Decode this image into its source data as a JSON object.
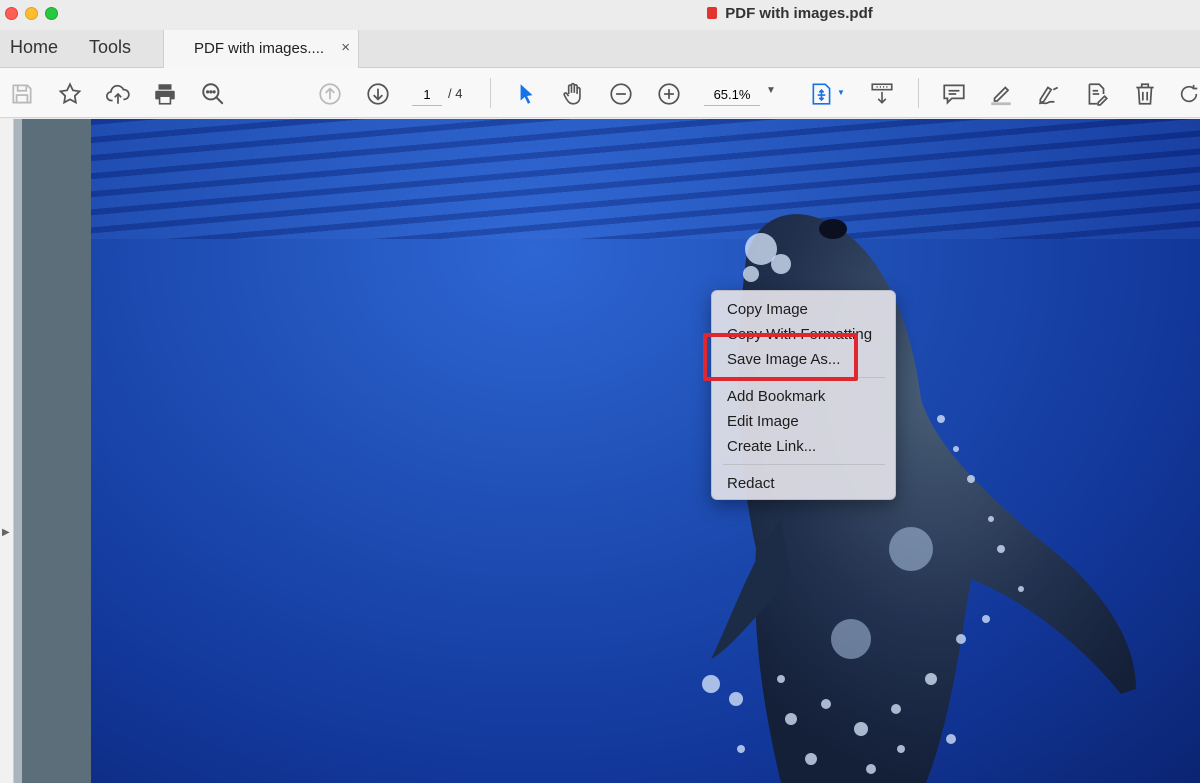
{
  "window": {
    "title": "PDF with images.pdf"
  },
  "nav": {
    "home": "Home",
    "tools": "Tools"
  },
  "doc_tab": {
    "label": "PDF with images....",
    "close": "×"
  },
  "toolbar": {
    "page_current": "1",
    "page_total": "/ 4",
    "zoom": "65.1%",
    "icons": [
      "save-icon",
      "star-icon",
      "cloud-upload-icon",
      "print-icon",
      "search-icon",
      "page-up-icon",
      "page-down-icon",
      "select-arrow-icon",
      "hand-icon",
      "zoom-out-icon",
      "zoom-in-icon",
      "fit-page-icon",
      "scroll-mode-icon",
      "comment-icon",
      "highlight-icon",
      "sign-icon",
      "edit-pdf-icon",
      "delete-icon",
      "rotate-icon"
    ]
  },
  "context_menu": {
    "items": [
      "Copy Image",
      "Copy With Formatting",
      "Save Image As...",
      "Add Bookmark",
      "Edit Image",
      "Create Link...",
      "Redact"
    ],
    "highlighted": "Save Image As...",
    "highlight_color": "#e0262f"
  },
  "colors": {
    "water": "#1f4fb5",
    "accent_blue": "#1473e6"
  }
}
